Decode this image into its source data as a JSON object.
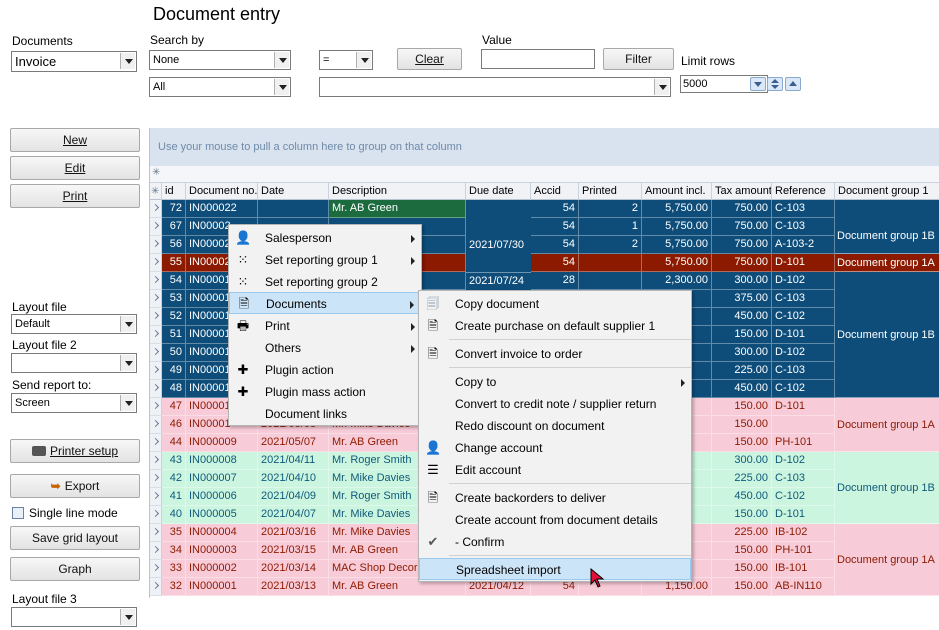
{
  "page": {
    "title": "Document entry"
  },
  "left": {
    "documents_label": "Documents",
    "documents_value": "Invoice",
    "buttons": {
      "new": "New",
      "edit": "Edit",
      "print": "Print"
    },
    "layout_file_label": "Layout file",
    "layout_file_value": "Default",
    "layout_file2_label": "Layout file 2",
    "layout_file2_value": "",
    "send_report_label": "Send report to:",
    "send_report_value": "Screen",
    "printer_setup": "Printer setup",
    "export": "Export",
    "single_line_mode": "Single line mode",
    "save_grid_layout": "Save grid layout",
    "graph": "Graph",
    "layout_file3_label": "Layout file 3",
    "layout_file3_value": ""
  },
  "search": {
    "search_by_label": "Search by",
    "search_by_value": "None",
    "operator_value": "=",
    "clear_button": "Clear",
    "value_label": "Value",
    "value_input": "",
    "filter_button": "Filter",
    "limit_rows_label": "Limit rows",
    "limit_rows_value": "5000",
    "second_field_value": "All",
    "second_value": ""
  },
  "grid": {
    "group_panel_text": "Use your mouse to pull a column here to group on that column",
    "columns": [
      "id",
      "Document no.",
      "Date",
      "Description",
      "Due date",
      "Accid",
      "Printed",
      "Amount incl.",
      "Tax amount",
      "Reference",
      "Document group 1"
    ],
    "rows": [
      {
        "id": "72",
        "docno": "IN000022",
        "date": "",
        "desc": "Mr. AB Green",
        "accid": "54",
        "printed": "2",
        "amount": "5,750.00",
        "tax": "750.00",
        "ref": "C-103"
      },
      {
        "id": "67",
        "docno": "IN00002",
        "date": "",
        "desc": "",
        "accid": "54",
        "printed": "1",
        "amount": "5,750.00",
        "tax": "750.00",
        "ref": "C-103"
      },
      {
        "id": "56",
        "docno": "IN00002",
        "date": "",
        "desc": "",
        "accid": "54",
        "printed": "2",
        "amount": "5,750.00",
        "tax": "750.00",
        "ref": "A-103-2"
      },
      {
        "id": "55",
        "docno": "IN00002",
        "date": "",
        "desc": "",
        "accid": "54",
        "printed": "",
        "amount": "5,750.00",
        "tax": "750.00",
        "ref": "D-101"
      },
      {
        "id": "54",
        "docno": "IN00001",
        "date": "",
        "desc": "",
        "accid": "28",
        "printed": "",
        "amount": "2,300.00",
        "tax": "300.00",
        "ref": "D-102"
      },
      {
        "id": "53",
        "docno": "IN00001",
        "date": "",
        "desc": "",
        "accid": "",
        "printed": "",
        "amount": "",
        "tax": "375.00",
        "ref": "C-103"
      },
      {
        "id": "52",
        "docno": "IN00001",
        "date": "",
        "desc": "",
        "accid": "",
        "printed": "",
        "amount": "",
        "tax": "450.00",
        "ref": "C-102"
      },
      {
        "id": "51",
        "docno": "IN00001",
        "date": "",
        "desc": "",
        "accid": "",
        "printed": "",
        "amount": "",
        "tax": "150.00",
        "ref": "D-101"
      },
      {
        "id": "50",
        "docno": "IN00001",
        "date": "",
        "desc": "",
        "accid": "",
        "printed": "",
        "amount": "",
        "tax": "300.00",
        "ref": "D-102"
      },
      {
        "id": "49",
        "docno": "IN00001",
        "date": "",
        "desc": "",
        "accid": "",
        "printed": "",
        "amount": "",
        "tax": "225.00",
        "ref": "C-103"
      },
      {
        "id": "48",
        "docno": "IN00001",
        "date": "",
        "desc": "",
        "accid": "",
        "printed": "",
        "amount": "",
        "tax": "450.00",
        "ref": "C-102"
      },
      {
        "id": "47",
        "docno": "IN00001",
        "date": "",
        "desc": "",
        "accid": "",
        "printed": "",
        "amount": "",
        "tax": "150.00",
        "ref": "D-101"
      },
      {
        "id": "46",
        "docno": "IN00001",
        "date": "2021/05/08",
        "desc": "Mr. Mike Davies",
        "accid": "",
        "printed": "",
        "amount": "",
        "tax": "150.00",
        "ref": ""
      },
      {
        "id": "44",
        "docno": "IN000009",
        "date": "2021/05/07",
        "desc": "Mr. AB Green",
        "accid": "",
        "printed": "",
        "amount": "",
        "tax": "150.00",
        "ref": "PH-101"
      },
      {
        "id": "43",
        "docno": "IN000008",
        "date": "2021/04/11",
        "desc": "Mr. Roger Smith",
        "accid": "",
        "printed": "",
        "amount": "",
        "tax": "300.00",
        "ref": "D-102"
      },
      {
        "id": "42",
        "docno": "IN000007",
        "date": "2021/04/10",
        "desc": "Mr. Mike Davies",
        "accid": "",
        "printed": "",
        "amount": "",
        "tax": "225.00",
        "ref": "C-103"
      },
      {
        "id": "41",
        "docno": "IN000006",
        "date": "2021/04/09",
        "desc": "Mr. Roger Smith",
        "accid": "",
        "printed": "",
        "amount": "",
        "tax": "450.00",
        "ref": "C-102"
      },
      {
        "id": "40",
        "docno": "IN000005",
        "date": "2021/04/07",
        "desc": "Mr. Mike Davies",
        "accid": "",
        "printed": "",
        "amount": "",
        "tax": "150.00",
        "ref": "D-101"
      },
      {
        "id": "35",
        "docno": "IN000004",
        "date": "2021/03/16",
        "desc": "Mr. Mike Davies",
        "accid": "",
        "printed": "",
        "amount": "",
        "tax": "225.00",
        "ref": "IB-102"
      },
      {
        "id": "34",
        "docno": "IN000003",
        "date": "2021/03/15",
        "desc": "Mr. AB Green",
        "accid": "",
        "printed": "",
        "amount": "",
        "tax": "150.00",
        "ref": "PH-101"
      },
      {
        "id": "33",
        "docno": "IN000002",
        "date": "2021/03/14",
        "desc": "MAC Shop Decor",
        "accid": "",
        "printed": "",
        "amount": "",
        "tax": "150.00",
        "ref": "IB-101"
      },
      {
        "id": "32",
        "docno": "IN000001",
        "date": "2021/03/13",
        "desc": "Mr. AB Green",
        "due": "2021/04/12",
        "accid": "54",
        "printed": "",
        "amount": "1,150.00",
        "tax": "150.00",
        "ref": "AB-IN110"
      }
    ],
    "due_merged_1": "2021/07/30",
    "due_row5": "2021/07/24",
    "groups": [
      "Document group 1B",
      "Document group 1A",
      "Document group 1B",
      "Document group 1A",
      "Document group 1B",
      "Document group 1A"
    ]
  },
  "context_menu": {
    "items": [
      "Salesperson",
      "Set reporting group 1",
      "Set reporting group 2",
      "Documents",
      "Print",
      "Others",
      "Plugin action",
      "Plugin mass action",
      "Document links"
    ]
  },
  "submenu": {
    "items": [
      "Copy document",
      "Create purchase on default supplier 1",
      "Convert invoice to order",
      "Copy to",
      "Convert to credit note / supplier return",
      "Redo discount on document",
      "Change account",
      "Edit account",
      "Create backorders to deliver",
      "Create account from document details",
      "- Confirm",
      "Spreadsheet import"
    ]
  },
  "colors": {
    "selected": "#0e4d7a",
    "highlight_red": "#8b1a00",
    "pink": "#f8cbd8",
    "green": "#ccf5e0"
  }
}
